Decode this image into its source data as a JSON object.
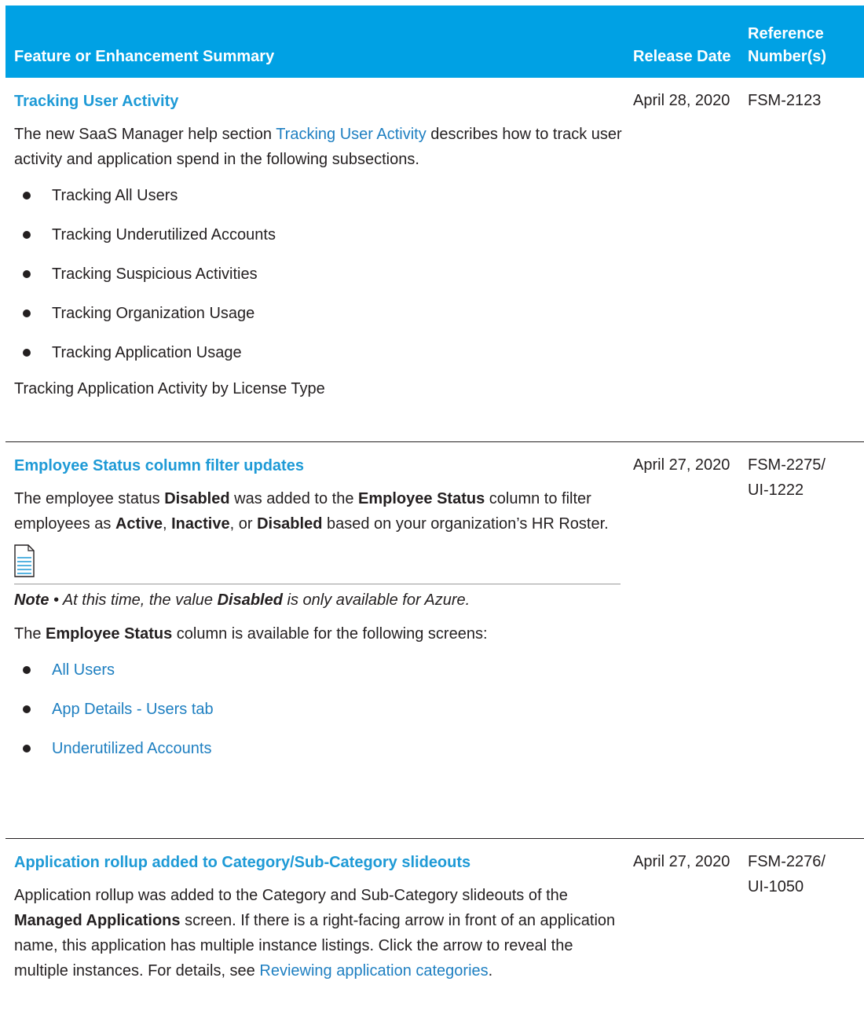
{
  "header": {
    "summary": "Feature or Enhancement Summary",
    "release_date": "Release Date",
    "reference_line1": "Reference",
    "reference_line2": "Number(s)"
  },
  "rows": [
    {
      "title": "Tracking User Activity",
      "date": "April 28, 2020",
      "ref_line1": "FSM-2123",
      "ref_line2": "",
      "intro_before": "The new SaaS Manager help section ",
      "intro_link": "Tracking User Activity",
      "intro_after": " describes how to track user activity and application spend in the following subsections.",
      "bullets": [
        "Tracking All Users",
        "Tracking Underutilized Accounts",
        "Tracking Suspicious Activities",
        "Tracking Organization Usage",
        "Tracking Application Usage"
      ],
      "trailing": "Tracking Application Activity by License Type"
    },
    {
      "title": "Employee Status column filter updates",
      "date": "April 27, 2020",
      "ref_line1": "FSM-2275/",
      "ref_line2": "UI-1222",
      "p1_a": "The employee status ",
      "p1_b": "Disabled",
      "p1_c": " was added to the ",
      "p1_d": "Employee Status",
      "p1_e": " column to filter employees as ",
      "p1_f": "Active",
      "p1_g": ", ",
      "p1_h": "Inactive",
      "p1_i": ", or ",
      "p1_j": "Disabled",
      "p1_k": " based on your organization’s HR Roster.",
      "note_label": "Note",
      "note_a": " • At this time, the value ",
      "note_b": "Disabled",
      "note_c": " is only available for Azure.",
      "p2_a": "The ",
      "p2_b": "Employee Status",
      "p2_c": " column is available for the following screens:",
      "links": [
        "All Users",
        "App Details - Users tab",
        "Underutilized Accounts"
      ]
    },
    {
      "title": "Application rollup added to Category/Sub-Category slideouts",
      "date": "April 27, 2020",
      "ref_line1": "FSM-2276/",
      "ref_line2": "UI-1050",
      "p_a": "Application rollup was added to the Category and Sub-Category slideouts of the ",
      "p_b": "Managed Applications",
      "p_c": " screen. If there is a right-facing arrow in front of an application name, this application has multiple instance listings. Click the arrow to reveal the multiple instances. For details, see ",
      "p_link": "Reviewing application categories",
      "p_d": "."
    }
  ],
  "colors": {
    "header_bg": "#00a1e4",
    "title": "#1e9ad6",
    "link": "#1e7fc1",
    "text": "#231f20"
  },
  "icons": {
    "note": "note-document-icon"
  }
}
